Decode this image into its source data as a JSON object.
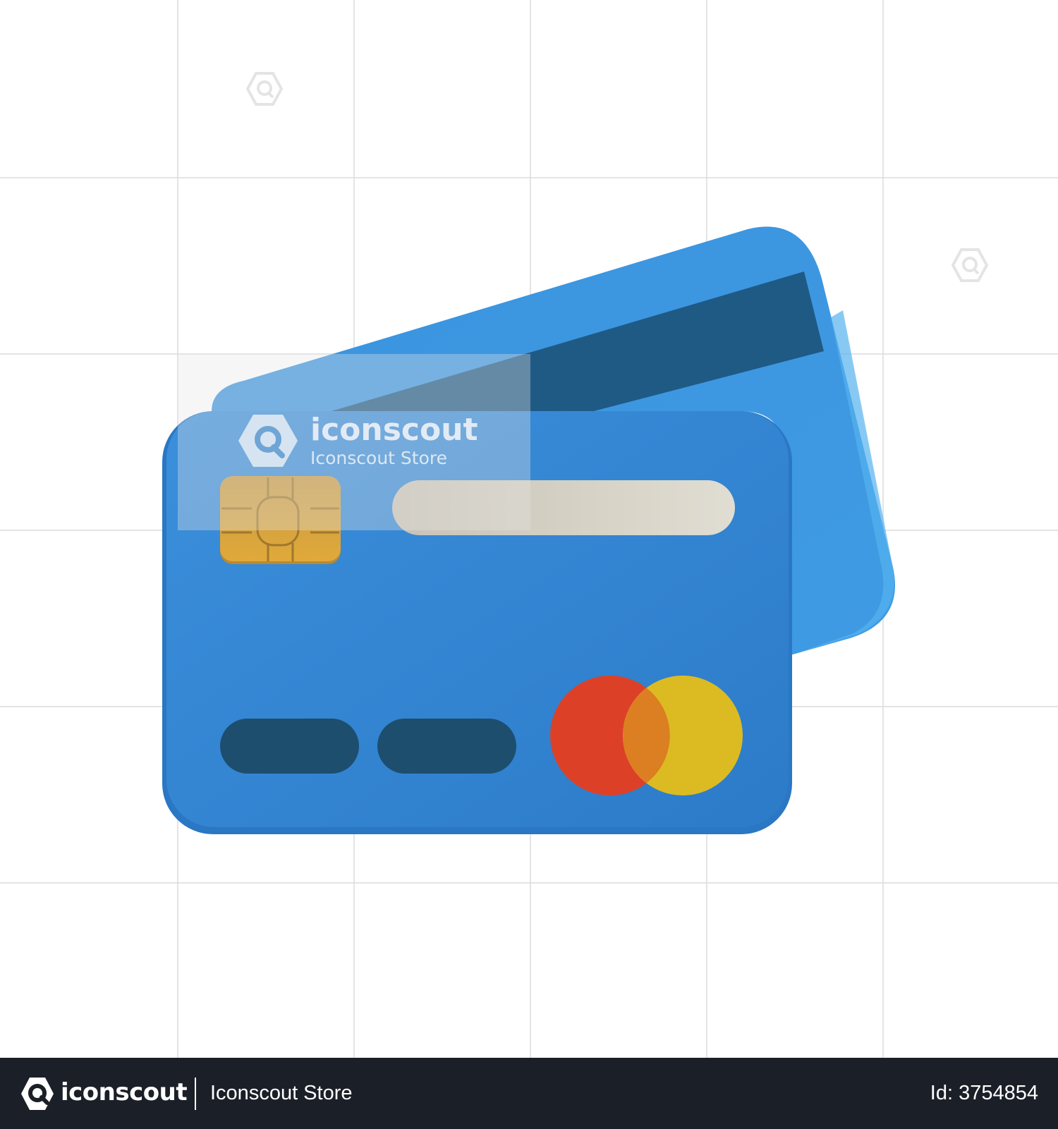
{
  "watermark": {
    "brand": "iconscout",
    "store": "Iconscout Store"
  },
  "footer": {
    "brand": "iconscout",
    "store": "Iconscout Store",
    "id_label": "Id: 3754854"
  },
  "colors": {
    "card_front": "#3389d6",
    "card_back": "#3c96e0",
    "magnetic_stripe": "#1f5a85",
    "chip": "#d9a53a",
    "name_bar": "#dcd8cc",
    "number_pills": "#1d4e6e",
    "circle_red": "#dc4128",
    "circle_yellow": "#dcbb22",
    "footer_bg": "#1b1f27"
  },
  "icons": {
    "watermark_logo": "iconscout-logo-icon",
    "footer_logo": "iconscout-logo-icon"
  }
}
